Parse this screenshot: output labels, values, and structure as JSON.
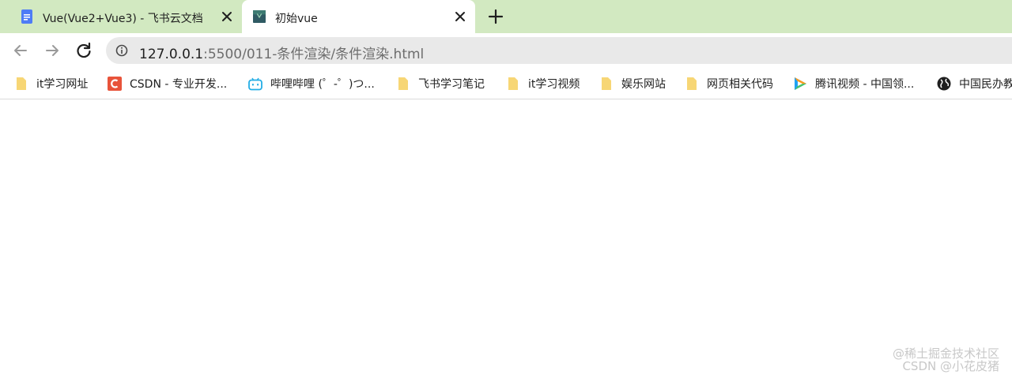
{
  "tabs": [
    {
      "title": "Vue(Vue2+Vue3) - 飞书云文档",
      "icon": "document-icon",
      "active": false
    },
    {
      "title": "初始vue",
      "icon": "vue-icon",
      "active": true
    }
  ],
  "toolbar": {
    "url_host": "127.0.0.1",
    "url_rest": ":5500/011-条件渲染/条件渲染.html"
  },
  "bookmarks": [
    {
      "label": "it学习网址",
      "icon": "folder-icon"
    },
    {
      "label": "CSDN - 专业开发...",
      "icon": "csdn-icon"
    },
    {
      "label": "哔哩哔哩 (゜-゜)つ...",
      "icon": "bilibili-icon"
    },
    {
      "label": "飞书学习笔记",
      "icon": "folder-icon"
    },
    {
      "label": "it学习视频",
      "icon": "folder-icon"
    },
    {
      "label": "娱乐网站",
      "icon": "folder-icon"
    },
    {
      "label": "网页相关代码",
      "icon": "folder-icon"
    },
    {
      "label": "腾讯视频 - 中国领...",
      "icon": "tencent-video-icon"
    },
    {
      "label": "中国民办教",
      "icon": "globe-icon"
    }
  ],
  "watermark": {
    "line1": "@稀土掘金技术社区",
    "line2": "CSDN @小花皮猪"
  },
  "colors": {
    "tabstrip": "#d2e9c1",
    "omnibox": "#e9e9e9",
    "folder": "#f7d675",
    "csdn": "#e8533a",
    "bilibili": "#23ade5"
  }
}
